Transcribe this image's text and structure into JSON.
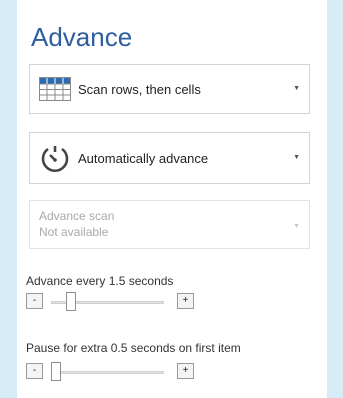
{
  "panel": {
    "title": "Advance"
  },
  "scan_mode": {
    "label": "Scan rows, then cells",
    "icon": "grid-icon"
  },
  "advance_mode": {
    "label": "Automatically advance",
    "icon": "timer-icon"
  },
  "advance_scan": {
    "title": "Advance scan",
    "status": "Not available",
    "disabled": true
  },
  "advance_every": {
    "label": "Advance every 1.5 seconds",
    "minus": "-",
    "plus": "+",
    "value_fraction": 0.15
  },
  "pause_first": {
    "label": "Pause for extra 0.5 seconds on first item",
    "minus": "-",
    "plus": "+",
    "value_fraction": 0.0
  },
  "colors": {
    "background": "#d6ecf6",
    "title": "#2e5e9e",
    "grid_icon": "#2d6bb3"
  }
}
